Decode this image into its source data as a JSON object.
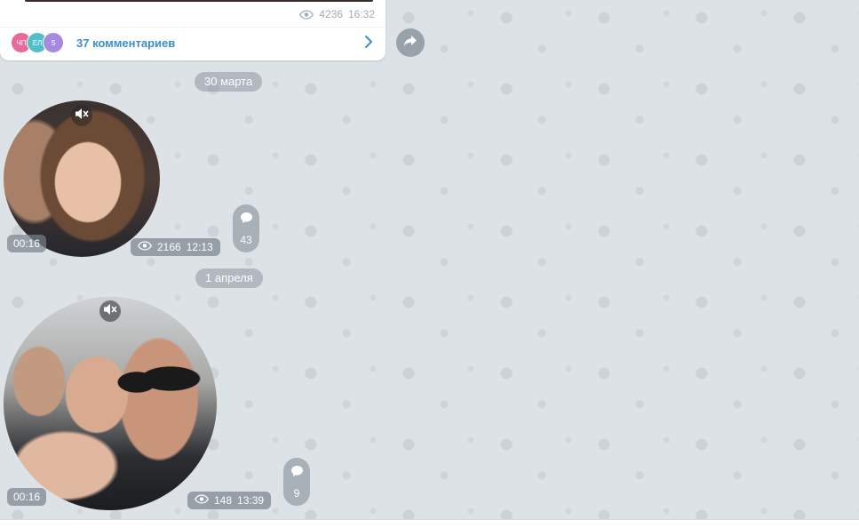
{
  "colors": {
    "chat_background": "#dde2e6",
    "link_accent": "#3a8fc8",
    "avatar_1": "#e86a9b",
    "avatar_2": "#4fc0c8",
    "avatar_3": "#a58be0"
  },
  "previous_post": {
    "views": "4236",
    "time": "16:32",
    "commenters": [
      {
        "initials": "ЧП",
        "color": "#e86a9b"
      },
      {
        "initials": "ЕЛ",
        "color": "#4fc0c8"
      },
      {
        "initials": "S",
        "color": "#a58be0"
      }
    ],
    "comments_label": "37 комментариев",
    "icons": {
      "views": "eye-icon",
      "open": "chevron-right-icon",
      "share": "share-arrow-icon"
    }
  },
  "date_separators": [
    "30 марта",
    "1 апреля"
  ],
  "video_messages": [
    {
      "duration": "00:16",
      "views": "2166",
      "time": "12:13",
      "comments_count": "43",
      "icons": {
        "sound": "mute-icon",
        "comments": "comment-bubble-icon"
      }
    },
    {
      "duration": "00:16",
      "views": "148",
      "time": "13:39",
      "comments_count": "9",
      "icons": {
        "sound": "mute-icon",
        "comments": "comment-bubble-icon"
      }
    }
  ]
}
